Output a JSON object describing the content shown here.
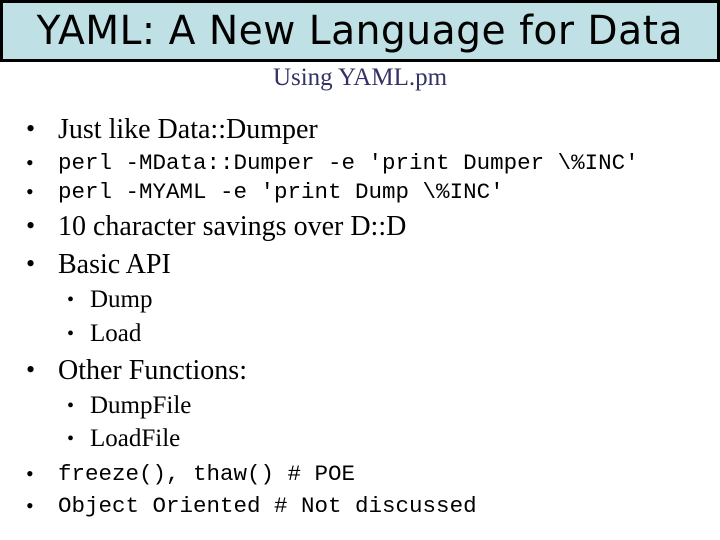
{
  "slide": {
    "title": "YAML: A New Language for Data",
    "subtitle": "Using YAML.pm",
    "bullets": [
      {
        "level": 1,
        "style": "serif",
        "text": "Just like Data::Dumper"
      },
      {
        "level": 1,
        "style": "code",
        "text": "perl -MData::Dumper -e 'print Dumper \\%INC'"
      },
      {
        "level": 1,
        "style": "code",
        "text": "perl -MYAML -e 'print Dump \\%INC'"
      },
      {
        "level": 1,
        "style": "serif",
        "text": "10 character savings over D::D"
      },
      {
        "level": 1,
        "style": "serif",
        "text": "Basic API"
      },
      {
        "level": 2,
        "style": "serif",
        "text": "Dump"
      },
      {
        "level": 2,
        "style": "serif",
        "text": "Load"
      },
      {
        "level": 1,
        "style": "serif",
        "text": "Other Functions:"
      },
      {
        "level": 2,
        "style": "serif",
        "text": "DumpFile"
      },
      {
        "level": 2,
        "style": "serif",
        "text": "LoadFile"
      },
      {
        "level": 1,
        "style": "code",
        "text": "freeze(), thaw() # POE"
      },
      {
        "level": 1,
        "style": "code",
        "text": "Object Oriented # Not discussed"
      }
    ],
    "bullet_glyph": "•",
    "colors": {
      "title_bg": "#bfe0e4",
      "title_border": "#000000",
      "subtitle": "#333366",
      "text": "#000000"
    }
  }
}
